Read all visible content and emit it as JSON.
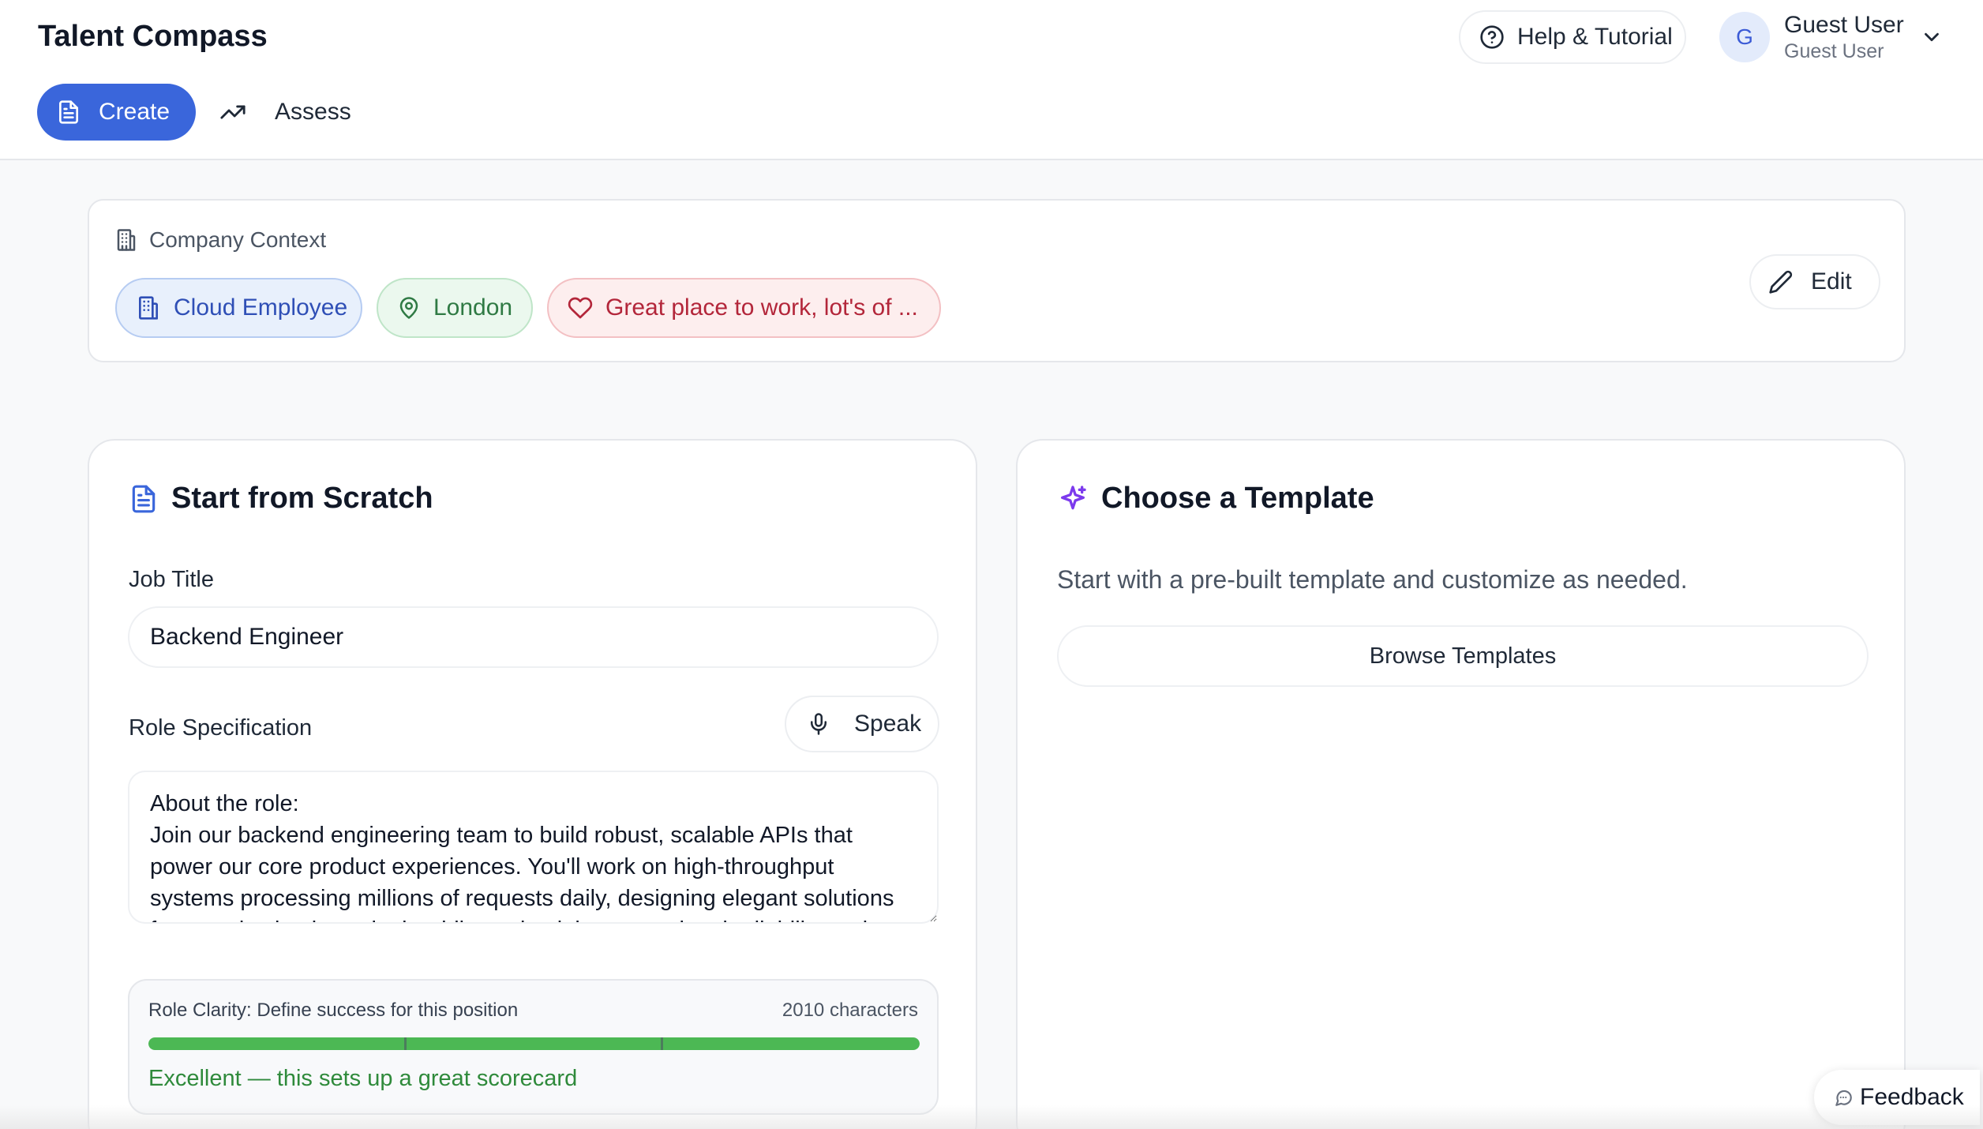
{
  "app": {
    "title": "Talent Compass"
  },
  "header": {
    "help_label": "Help & Tutorial",
    "user": {
      "initial": "G",
      "name": "Guest User",
      "subtitle": "Guest User"
    }
  },
  "nav": {
    "tabs": [
      {
        "label": "Create",
        "icon": "document-icon",
        "active": true
      },
      {
        "label": "Assess",
        "icon": "trending-up-icon",
        "active": false
      }
    ]
  },
  "company_context": {
    "heading": "Company Context",
    "chips": [
      {
        "label": "Cloud Employee",
        "icon": "building-icon",
        "color": "#2f4fb6"
      },
      {
        "label": "London",
        "icon": "map-pin-icon",
        "color": "#2f7a44"
      },
      {
        "label": "Great place to work, lot's of ...",
        "icon": "heart-icon",
        "color": "#b3263a"
      }
    ],
    "edit_label": "Edit"
  },
  "scratch": {
    "title": "Start from Scratch",
    "job_title_label": "Job Title",
    "job_title_value": "Backend Engineer",
    "role_spec_label": "Role Specification",
    "speak_label": "Speak",
    "role_spec_value": "About the role:\nJoin our backend engineering team to build robust, scalable APIs that power our core product experiences. You'll work on high-throughput systems processing millions of requests daily, designing elegant solutions for complex business logic whilst maintaining exceptional reliability and performance. This is a hands-on role perfect for an engineer who thrives...",
    "clarity": {
      "label": "Role Clarity: Define success for this position",
      "count": "2010 characters",
      "progress": 1.0,
      "message": "Excellent — this sets up a great scorecard",
      "color": "#4cb854"
    }
  },
  "template": {
    "title": "Choose a Template",
    "description": "Start with a pre-built template and customize as needed.",
    "browse_label": "Browse Templates"
  },
  "feedback": {
    "label": "Feedback"
  },
  "colors": {
    "primary": "#3a66db",
    "accent_purple": "#7c3aed",
    "success": "#2f8a3b"
  }
}
